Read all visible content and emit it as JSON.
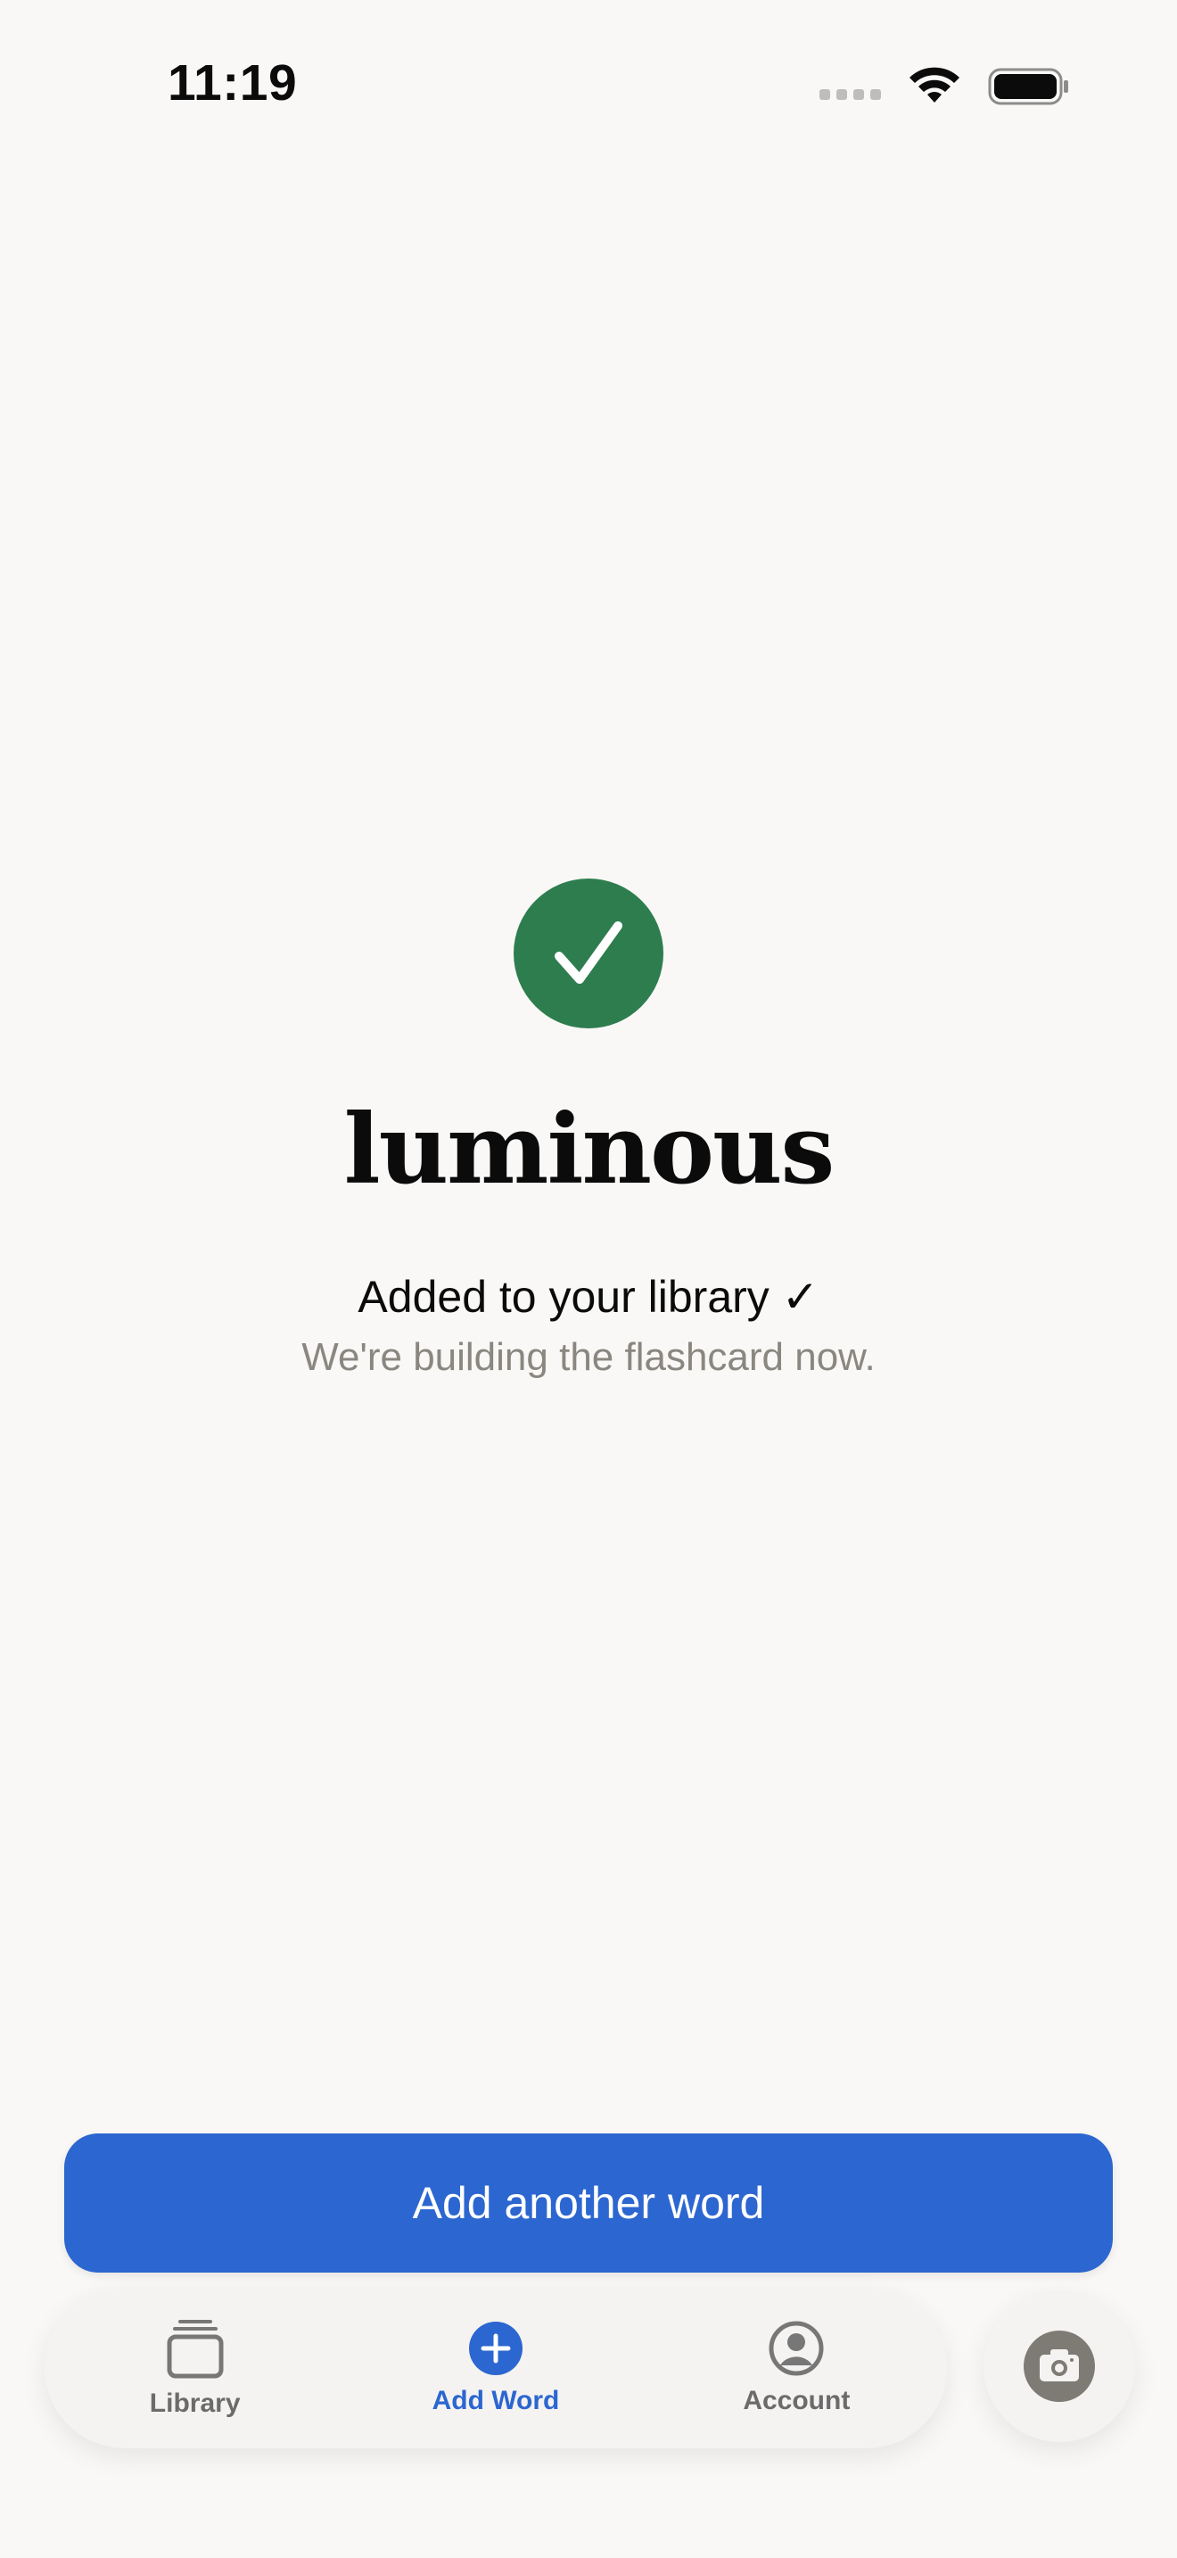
{
  "status_bar": {
    "time": "11:19",
    "icons": [
      "signal-icon",
      "wifi-icon",
      "battery-icon"
    ]
  },
  "confirmation": {
    "icon": "checkmark-icon",
    "word": "luminous",
    "added_message": "Added to your library ✓",
    "sub_message": "We're building the flashcard now."
  },
  "actions": {
    "add_another_label": "Add another word"
  },
  "tab_bar": {
    "tabs": [
      {
        "label": "Library",
        "icon": "library-icon",
        "active": false
      },
      {
        "label": "Add Word",
        "icon": "add-circle-icon",
        "active": true
      },
      {
        "label": "Account",
        "icon": "account-icon",
        "active": false
      }
    ],
    "camera_icon": "camera-icon"
  },
  "colors": {
    "background": "#F9F8F6",
    "accent": "#2C66D0",
    "success": "#2E7D4F",
    "muted_text": "#8A8780"
  }
}
